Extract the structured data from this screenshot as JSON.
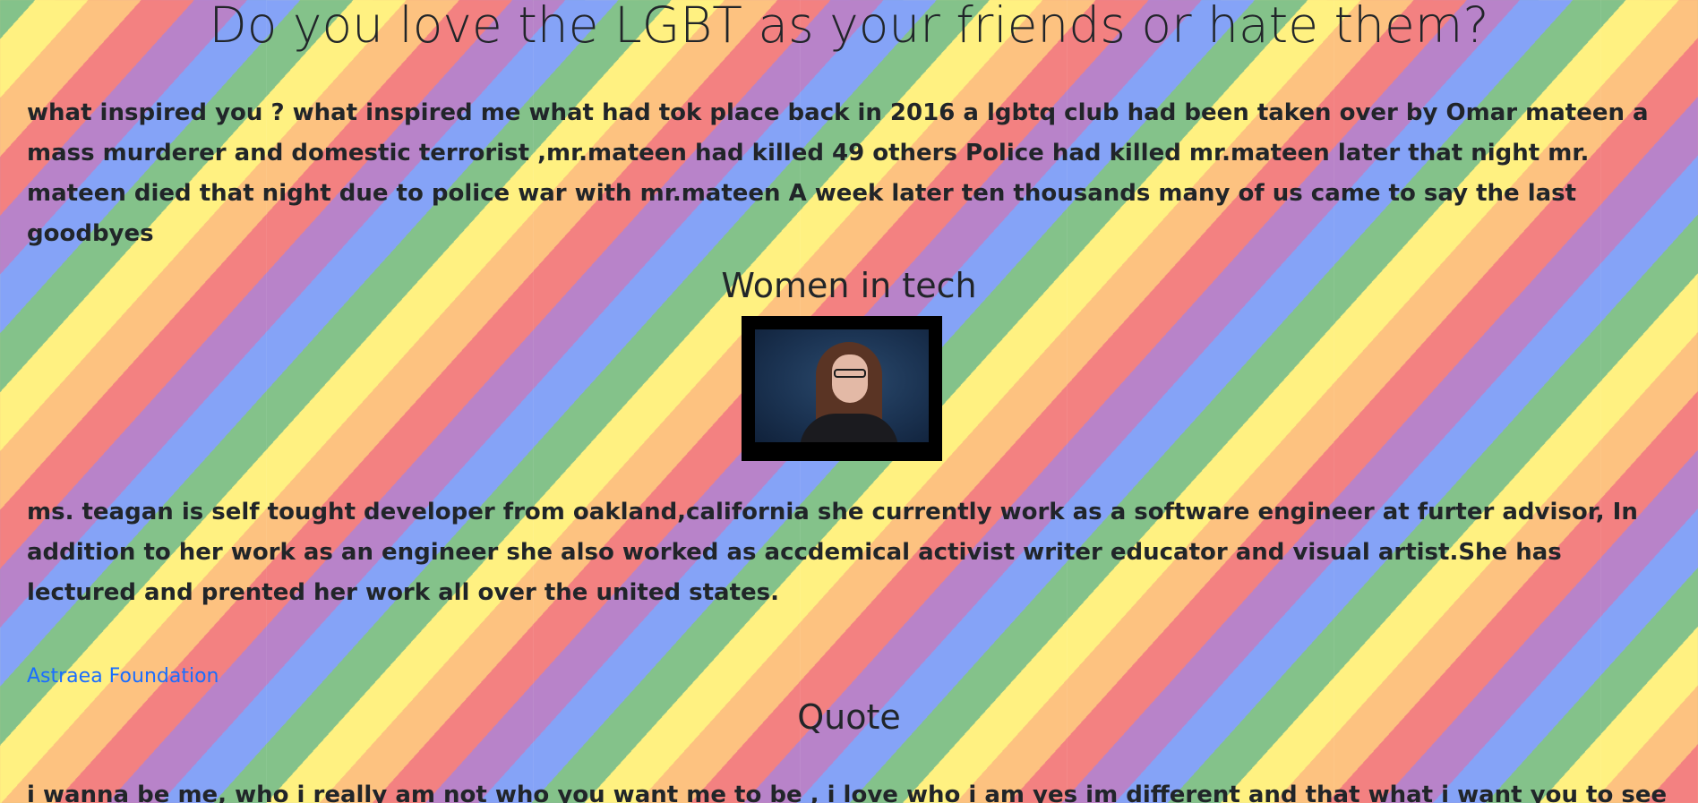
{
  "page": {
    "title": "Do you love the LGBT as your friends or hate them?"
  },
  "inspired_paragraph": "what inspired you ? what inspired me what had tok place back in 2016 a lgbtq club had been taken over by Omar mateen a mass murderer and domestic terrorist ,mr.mateen had killed 49 others Police had killed mr.mateen later that night mr. mateen died that night due to police war with mr.mateen A week later ten thousands many of us came to say the last goodbyes",
  "women_in_tech": {
    "heading": "Women in tech",
    "bio": "ms. teagan is self tought developer from oakland,california she currently work as a software engineer at furter advisor, In addition to her work as an engineer she also worked as accdemical activist writer educator and visual artist.She has lectured and prented her work all over the united states."
  },
  "link": {
    "label": "Astraea Foundation"
  },
  "quote": {
    "heading": "Quote",
    "text": "i wanna be me, who i really am not who you want me to be , i love who i am yes im different and that what i want you to see no"
  },
  "colors": {
    "text": "#212529",
    "link": "#1a6dff",
    "stripes": [
      "#f38181",
      "#fdc280",
      "#fff181",
      "#84c28a",
      "#85a3f7",
      "#b883c9"
    ]
  }
}
